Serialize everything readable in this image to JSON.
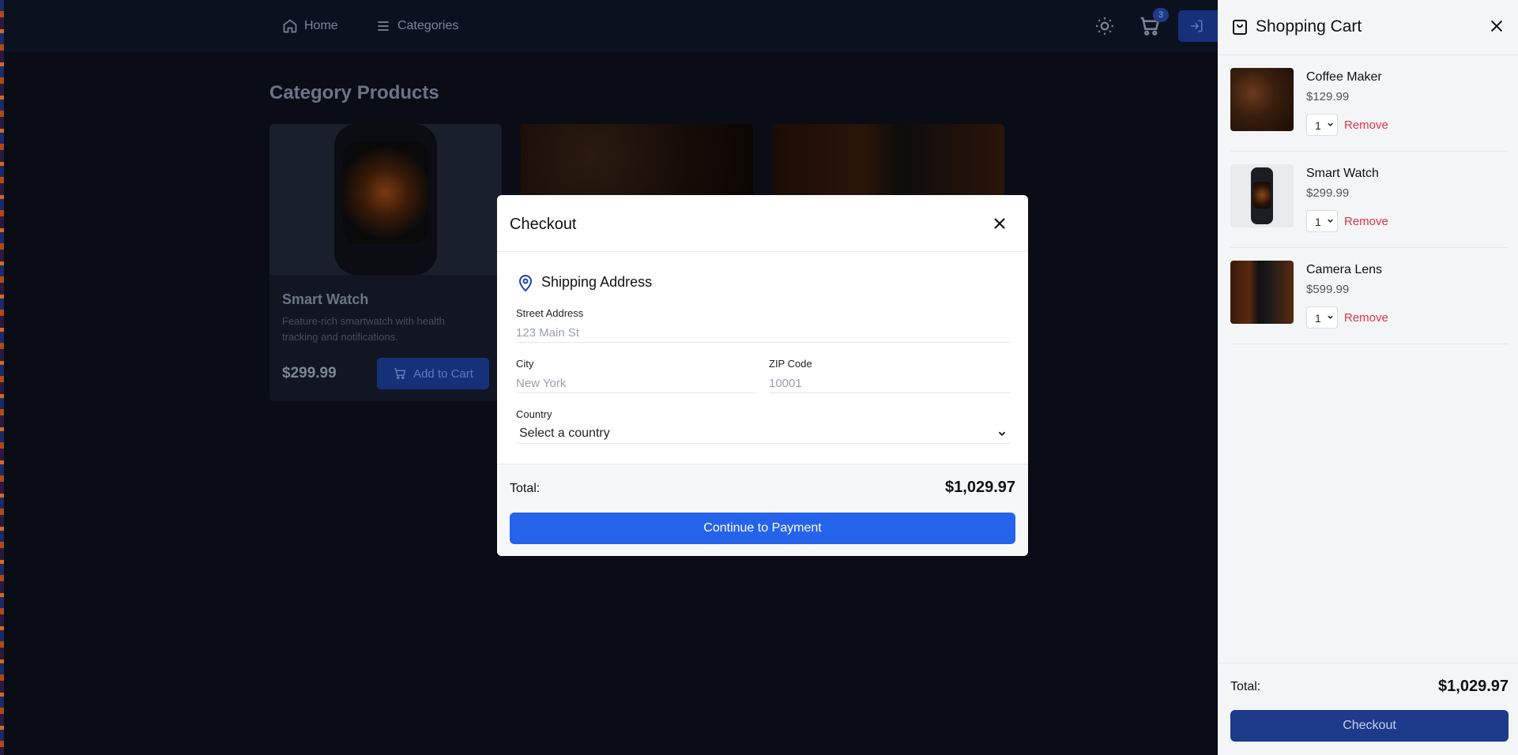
{
  "nav": {
    "home_label": "Home",
    "categories_label": "Categories",
    "cart_count": "3"
  },
  "page": {
    "title": "Category Products",
    "card": {
      "name": "Smart Watch",
      "description": "Feature-rich smartwatch with health tracking and notifications.",
      "price": "$299.99",
      "add_label": "Add to Cart"
    }
  },
  "modal": {
    "title": "Checkout",
    "section_title": "Shipping Address",
    "street_label": "Street Address",
    "street_placeholder": "123 Main St",
    "city_label": "City",
    "city_placeholder": "New York",
    "zip_label": "ZIP Code",
    "zip_placeholder": "10001",
    "country_label": "Country",
    "country_value": "Select a country",
    "total_label": "Total:",
    "total_value": "$1,029.97",
    "pay_label": "Continue to Payment"
  },
  "cart": {
    "title": "Shopping Cart",
    "items": [
      {
        "name": "Coffee Maker",
        "price": "$129.99",
        "qty": "1",
        "remove": "Remove"
      },
      {
        "name": "Smart Watch",
        "price": "$299.99",
        "qty": "1",
        "remove": "Remove"
      },
      {
        "name": "Camera Lens",
        "price": "$599.99",
        "qty": "1",
        "remove": "Remove"
      }
    ],
    "total_label": "Total:",
    "total_value": "$1,029.97",
    "checkout_label": "Checkout"
  },
  "icons": [
    "home-icon",
    "menu-icon",
    "sun-icon",
    "cart-icon",
    "login-icon",
    "close-icon",
    "map-pin-icon",
    "chevron-down-icon",
    "shopping-bag-icon"
  ],
  "colors": {
    "accent": "#2563eb",
    "danger": "#dc3545"
  }
}
